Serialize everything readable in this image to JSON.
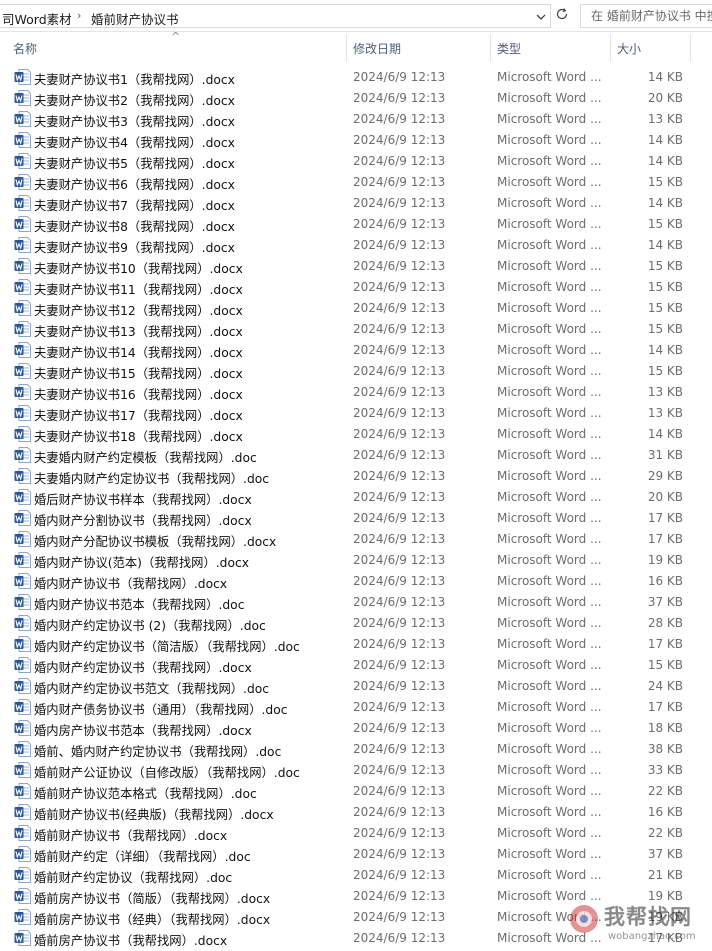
{
  "address_bar": {
    "crumbs": [
      "司Word素材",
      "婚前财产协议书"
    ],
    "search_placeholder": "在 婚前财产协议书 中搜索"
  },
  "columns": {
    "name": "名称",
    "date": "修改日期",
    "type": "类型",
    "size": "大小"
  },
  "files": [
    {
      "name": "夫妻财产协议书1（我帮找网）.docx",
      "date": "2024/6/9 12:13",
      "type": "Microsoft Word ...",
      "size": "14 KB"
    },
    {
      "name": "夫妻财产协议书2（我帮找网）.docx",
      "date": "2024/6/9 12:13",
      "type": "Microsoft Word ...",
      "size": "20 KB"
    },
    {
      "name": "夫妻财产协议书3（我帮找网）.docx",
      "date": "2024/6/9 12:13",
      "type": "Microsoft Word ...",
      "size": "13 KB"
    },
    {
      "name": "夫妻财产协议书4（我帮找网）.docx",
      "date": "2024/6/9 12:13",
      "type": "Microsoft Word ...",
      "size": "14 KB"
    },
    {
      "name": "夫妻财产协议书5（我帮找网）.docx",
      "date": "2024/6/9 12:13",
      "type": "Microsoft Word ...",
      "size": "14 KB"
    },
    {
      "name": "夫妻财产协议书6（我帮找网）.docx",
      "date": "2024/6/9 12:13",
      "type": "Microsoft Word ...",
      "size": "15 KB"
    },
    {
      "name": "夫妻财产协议书7（我帮找网）.docx",
      "date": "2024/6/9 12:13",
      "type": "Microsoft Word ...",
      "size": "14 KB"
    },
    {
      "name": "夫妻财产协议书8（我帮找网）.docx",
      "date": "2024/6/9 12:13",
      "type": "Microsoft Word ...",
      "size": "15 KB"
    },
    {
      "name": "夫妻财产协议书9（我帮找网）.docx",
      "date": "2024/6/9 12:13",
      "type": "Microsoft Word ...",
      "size": "14 KB"
    },
    {
      "name": "夫妻财产协议书10（我帮找网）.docx",
      "date": "2024/6/9 12:13",
      "type": "Microsoft Word ...",
      "size": "15 KB"
    },
    {
      "name": "夫妻财产协议书11（我帮找网）.docx",
      "date": "2024/6/9 12:13",
      "type": "Microsoft Word ...",
      "size": "15 KB"
    },
    {
      "name": "夫妻财产协议书12（我帮找网）.docx",
      "date": "2024/6/9 12:13",
      "type": "Microsoft Word ...",
      "size": "15 KB"
    },
    {
      "name": "夫妻财产协议书13（我帮找网）.docx",
      "date": "2024/6/9 12:13",
      "type": "Microsoft Word ...",
      "size": "15 KB"
    },
    {
      "name": "夫妻财产协议书14（我帮找网）.docx",
      "date": "2024/6/9 12:13",
      "type": "Microsoft Word ...",
      "size": "14 KB"
    },
    {
      "name": "夫妻财产协议书15（我帮找网）.docx",
      "date": "2024/6/9 12:13",
      "type": "Microsoft Word ...",
      "size": "15 KB"
    },
    {
      "name": "夫妻财产协议书16（我帮找网）.docx",
      "date": "2024/6/9 12:13",
      "type": "Microsoft Word ...",
      "size": "13 KB"
    },
    {
      "name": "夫妻财产协议书17（我帮找网）.docx",
      "date": "2024/6/9 12:13",
      "type": "Microsoft Word ...",
      "size": "13 KB"
    },
    {
      "name": "夫妻财产协议书18（我帮找网）.docx",
      "date": "2024/6/9 12:13",
      "type": "Microsoft Word ...",
      "size": "14 KB"
    },
    {
      "name": "夫妻婚内财产约定模板（我帮找网）.doc",
      "date": "2024/6/9 12:13",
      "type": "Microsoft Word ...",
      "size": "31 KB"
    },
    {
      "name": "夫妻婚内财产约定协议书（我帮找网）.doc",
      "date": "2024/6/9 12:13",
      "type": "Microsoft Word ...",
      "size": "29 KB"
    },
    {
      "name": "婚后财产协议书样本（我帮找网）.docx",
      "date": "2024/6/9 12:13",
      "type": "Microsoft Word ...",
      "size": "20 KB"
    },
    {
      "name": "婚内财产分割协议书（我帮找网）.docx",
      "date": "2024/6/9 12:13",
      "type": "Microsoft Word ...",
      "size": "17 KB"
    },
    {
      "name": "婚内财产分配协议书模板（我帮找网）.docx",
      "date": "2024/6/9 12:13",
      "type": "Microsoft Word ...",
      "size": "17 KB"
    },
    {
      "name": "婚内财产协议(范本)（我帮找网）.docx",
      "date": "2024/6/9 12:13",
      "type": "Microsoft Word ...",
      "size": "19 KB"
    },
    {
      "name": "婚内财产协议书（我帮找网）.docx",
      "date": "2024/6/9 12:13",
      "type": "Microsoft Word ...",
      "size": "16 KB"
    },
    {
      "name": "婚内财产协议书范本（我帮找网）.doc",
      "date": "2024/6/9 12:13",
      "type": "Microsoft Word ...",
      "size": "37 KB"
    },
    {
      "name": "婚内财产约定协议书 (2)（我帮找网）.doc",
      "date": "2024/6/9 12:13",
      "type": "Microsoft Word ...",
      "size": "28 KB"
    },
    {
      "name": "婚内财产约定协议书（简洁版）（我帮找网）.doc",
      "date": "2024/6/9 12:13",
      "type": "Microsoft Word ...",
      "size": "17 KB"
    },
    {
      "name": "婚内财产约定协议书（我帮找网）.docx",
      "date": "2024/6/9 12:13",
      "type": "Microsoft Word ...",
      "size": "15 KB"
    },
    {
      "name": "婚内财产约定协议书范文（我帮找网）.doc",
      "date": "2024/6/9 12:13",
      "type": "Microsoft Word ...",
      "size": "24 KB"
    },
    {
      "name": "婚内财产债务协议书（通用）（我帮找网）.doc",
      "date": "2024/6/9 12:13",
      "type": "Microsoft Word ...",
      "size": "17 KB"
    },
    {
      "name": "婚内房产协议书范本（我帮找网）.docx",
      "date": "2024/6/9 12:13",
      "type": "Microsoft Word ...",
      "size": "18 KB"
    },
    {
      "name": "婚前、婚内财产约定协议书（我帮找网）.doc",
      "date": "2024/6/9 12:13",
      "type": "Microsoft Word ...",
      "size": "38 KB"
    },
    {
      "name": "婚前财产公证协议（自修改版）（我帮找网）.doc",
      "date": "2024/6/9 12:13",
      "type": "Microsoft Word ...",
      "size": "33 KB"
    },
    {
      "name": "婚前财产协议范本格式（我帮找网）.doc",
      "date": "2024/6/9 12:13",
      "type": "Microsoft Word ...",
      "size": "22 KB"
    },
    {
      "name": "婚前财产协议书(经典版)（我帮找网）.docx",
      "date": "2024/6/9 12:13",
      "type": "Microsoft Word ...",
      "size": "16 KB"
    },
    {
      "name": "婚前财产协议书（我帮找网）.docx",
      "date": "2024/6/9 12:13",
      "type": "Microsoft Word ...",
      "size": "22 KB"
    },
    {
      "name": "婚前财产约定（详细）（我帮找网）.doc",
      "date": "2024/6/9 12:13",
      "type": "Microsoft Word ...",
      "size": "37 KB"
    },
    {
      "name": "婚前财产约定协议（我帮找网）.doc",
      "date": "2024/6/9 12:13",
      "type": "Microsoft Word ...",
      "size": "21 KB"
    },
    {
      "name": "婚前房产协议书（简版）（我帮找网）.docx",
      "date": "2024/6/9 12:13",
      "type": "Microsoft Word ...",
      "size": "19 KB"
    },
    {
      "name": "婚前房产协议书（经典）（我帮找网）.docx",
      "date": "2024/6/9 12:13",
      "type": "Microsoft Word ...",
      "size": "19 KB"
    },
    {
      "name": "婚前房产协议书（我帮找网）.docx",
      "date": "2024/6/9 12:13",
      "type": "Microsoft Word ...",
      "size": "17 KB"
    }
  ],
  "watermark": {
    "text": "我帮找网",
    "url": "wobangzhao.com"
  },
  "colors": {
    "word_icon": "#2b579a",
    "header_text": "#4c607a",
    "muted_text": "#6d6d6d"
  }
}
